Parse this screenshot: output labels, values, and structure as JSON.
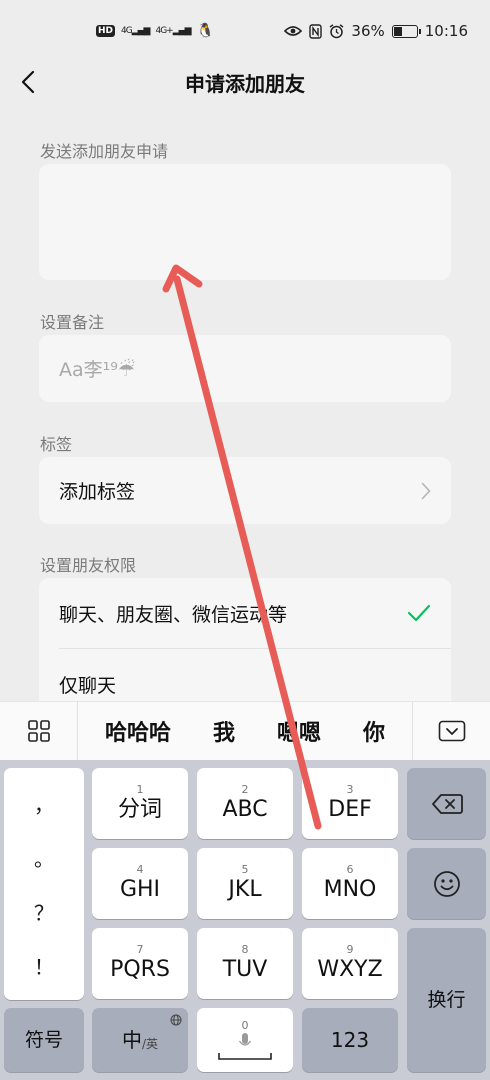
{
  "status_bar": {
    "left": [
      "HD",
      "4G",
      "4G+"
    ],
    "battery": "36%",
    "time": "10:16",
    "battery_level": 0.36
  },
  "nav": {
    "title": "申请添加朋友"
  },
  "request": {
    "label": "发送添加朋友申请",
    "value": ""
  },
  "remark": {
    "label": "设置备注",
    "placeholder": "Aa李¹⁹☔"
  },
  "tags": {
    "label": "标签",
    "add_label": "添加标签"
  },
  "permissions": {
    "label": "设置朋友权限",
    "options": [
      {
        "label": "聊天、朋友圈、微信运动等",
        "selected": true
      },
      {
        "label": "仅聊天",
        "selected": false
      }
    ]
  },
  "candidates": [
    "哈哈哈",
    "我",
    "嗯嗯",
    "你"
  ],
  "keyboard": {
    "punct": [
      "，",
      "。",
      "？",
      "！"
    ],
    "keys": [
      {
        "num": "1",
        "label": "分词"
      },
      {
        "num": "2",
        "label": "ABC"
      },
      {
        "num": "3",
        "label": "DEF"
      },
      {
        "num": "4",
        "label": "GHI"
      },
      {
        "num": "5",
        "label": "JKL"
      },
      {
        "num": "6",
        "label": "MNO"
      },
      {
        "num": "7",
        "label": "PQRS"
      },
      {
        "num": "8",
        "label": "TUV"
      },
      {
        "num": "9",
        "label": "WXYZ"
      }
    ],
    "symbols_label": "符号",
    "lang_main": "中",
    "lang_sub": "/英",
    "space_num": "0",
    "num_label": "123",
    "enter_label": "换行"
  },
  "colors": {
    "accent_check": "#07c160",
    "arrow": "#e85c57"
  }
}
